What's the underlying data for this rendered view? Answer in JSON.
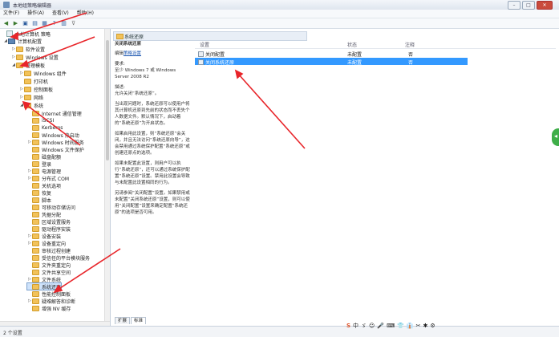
{
  "window": {
    "title": "本地组策略编辑器"
  },
  "menubar": {
    "items": [
      "文件(F)",
      "操作(A)",
      "查看(V)",
      "帮助(H)"
    ]
  },
  "tree": {
    "items": [
      {
        "label": "本地计算机 策略",
        "icon": "pc-icon"
      },
      {
        "label": "计算机配置",
        "icon": "pc-icon"
      },
      {
        "label": "软件设置",
        "icon": "folder-icon"
      },
      {
        "label": "Windows 设置",
        "icon": "folder-icon"
      },
      {
        "label": "管理模板",
        "icon": "folder-icon"
      },
      {
        "label": "Windows 组件",
        "icon": "folder-icon"
      },
      {
        "label": "打印机",
        "icon": "folder-icon"
      },
      {
        "label": "控制面板",
        "icon": "folder-icon"
      },
      {
        "label": "网络",
        "icon": "folder-icon"
      },
      {
        "label": "系统",
        "icon": "folder-icon"
      },
      {
        "label": "Internet 通信管理",
        "icon": "folder-icon"
      },
      {
        "label": "iSCSI",
        "icon": "folder-icon"
      },
      {
        "label": "Kerberos",
        "icon": "folder-icon"
      },
      {
        "label": "Windows 热启动",
        "icon": "folder-icon"
      },
      {
        "label": "Windows 时间服务",
        "icon": "folder-icon"
      },
      {
        "label": "Windows 文件保护",
        "icon": "folder-icon"
      },
      {
        "label": "磁盘配额",
        "icon": "folder-icon"
      },
      {
        "label": "登录",
        "icon": "folder-icon"
      },
      {
        "label": "电源管理",
        "icon": "folder-icon"
      },
      {
        "label": "分布式 COM",
        "icon": "folder-icon"
      },
      {
        "label": "关机选项",
        "icon": "folder-icon"
      },
      {
        "label": "恢复",
        "icon": "folder-icon"
      },
      {
        "label": "脚本",
        "icon": "folder-icon"
      },
      {
        "label": "可移动存储访问",
        "icon": "folder-icon"
      },
      {
        "label": "凭据分配",
        "icon": "folder-icon"
      },
      {
        "label": "区域设置服务",
        "icon": "folder-icon"
      },
      {
        "label": "驱动程序安装",
        "icon": "folder-icon"
      },
      {
        "label": "设备安装",
        "icon": "folder-icon"
      },
      {
        "label": "设备重定向",
        "icon": "folder-icon"
      },
      {
        "label": "审核过程创建",
        "icon": "folder-icon"
      },
      {
        "label": "受信任的平台模块服务",
        "icon": "folder-icon"
      },
      {
        "label": "文件夹重定向",
        "icon": "folder-icon"
      },
      {
        "label": "文件共享空间",
        "icon": "folder-icon"
      },
      {
        "label": "文件系统",
        "icon": "folder-icon"
      },
      {
        "label": "系统还原",
        "icon": "folder-icon"
      },
      {
        "label": "性能控制面板",
        "icon": "folder-icon"
      },
      {
        "label": "疑难解答和诊断",
        "icon": "folder-icon"
      },
      {
        "label": "增强 NV 缓存",
        "icon": "folder-icon"
      }
    ]
  },
  "rightpane": {
    "header": "系统还原",
    "desc": {
      "title": "关闭系统还原",
      "edit_prefix": "编辑",
      "edit_link": "策略设置",
      "req_label": "要求:",
      "req_text": "至少 Windows 7 或 Windows Server 2008 R2",
      "desc_label": "描述:",
      "desc_text": "允许关闭“系统还原”。",
      "p1": "当出现问题时，系统还原可以使用户将其计算机还原到先前的状态而不丢失个人数据文件。默认情况下，启动着的“系统还原”为开启状态。",
      "p2": "如果启用此设置，则“系统还原”会关闭，并且无法访问“系统还原向导”，这会禁用通过系统保护配置“系统还原”或创建还原点的选项。",
      "p3": "如果未配置此设置，则用户可以执行“系统还原”，还可以通过系统保护配置“系统还原”设置。禁用此设置会导致与未配置此设置相同的行为。",
      "p4": "另请参阅“关闭配置”设置。如果禁用或未配置“关闭系统还原”设置，则可以使用“关闭配置”设置来确定配置“系统还原”的选项是否可用。"
    },
    "list": {
      "headers": [
        "设置",
        "状态",
        "注释"
      ],
      "rows": [
        {
          "setting": "关闭配置",
          "state": "未配置",
          "note": "否"
        },
        {
          "setting": "关闭系统还原",
          "state": "未配置",
          "note": "否"
        }
      ]
    },
    "tabs": [
      "扩展",
      "标准"
    ]
  },
  "status": {
    "text": "2 个设置"
  },
  "ime": {
    "items": [
      "S",
      "中",
      "ゞ",
      "☺",
      "🎤",
      "⌨",
      "👕",
      "👔",
      "✂",
      "✱",
      "⚙"
    ]
  },
  "colors": {
    "selection": "#3399ff",
    "annotation": "#e8252a",
    "tree_selection": "#cfe3fb"
  }
}
